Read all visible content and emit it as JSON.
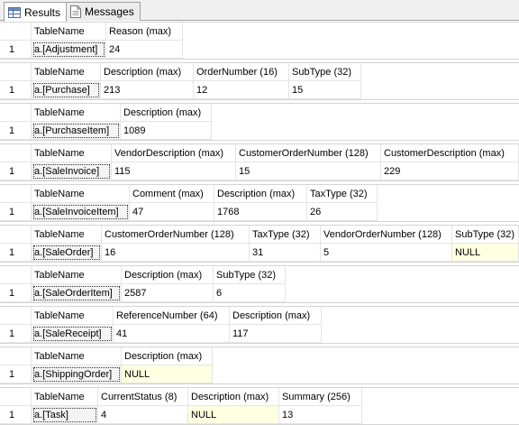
{
  "tabs": [
    {
      "label": "Results",
      "icon": "grid-icon",
      "active": true
    },
    {
      "label": "Messages",
      "icon": "document-icon",
      "active": false
    }
  ],
  "result_sets": [
    {
      "columns": [
        "TableName",
        "Reason (max)"
      ],
      "rows": [
        [
          "1",
          "a.[Adjustment]",
          "24"
        ]
      ]
    },
    {
      "columns": [
        "TableName",
        "Description (max)",
        "OrderNumber (16)",
        "SubType (32)"
      ],
      "rows": [
        [
          "1",
          "a.[Purchase]",
          "213",
          "12",
          "15"
        ]
      ]
    },
    {
      "columns": [
        "TableName",
        "Description (max)"
      ],
      "rows": [
        [
          "1",
          "a.[PurchaseItem]",
          "1089"
        ]
      ]
    },
    {
      "columns": [
        "TableName",
        "VendorDescription (max)",
        "CustomerOrderNumber (128)",
        "CustomerDescription (max)"
      ],
      "rows": [
        [
          "1",
          "a.[SaleInvoice]",
          "115",
          "15",
          "229"
        ]
      ]
    },
    {
      "columns": [
        "TableName",
        "Comment (max)",
        "Description (max)",
        "TaxType (32)"
      ],
      "rows": [
        [
          "1",
          "a.[SaleInvoiceItem]",
          "47",
          "1768",
          "26"
        ]
      ]
    },
    {
      "columns": [
        "TableName",
        "CustomerOrderNumber (128)",
        "TaxType (32)",
        "VendorOrderNumber (128)",
        "SubType (32)"
      ],
      "rows": [
        [
          "1",
          "a.[SaleOrder]",
          "16",
          "31",
          "5",
          "NULL"
        ]
      ]
    },
    {
      "columns": [
        "TableName",
        "Description (max)",
        "SubType (32)"
      ],
      "rows": [
        [
          "1",
          "a.[SaleOrderItem]",
          "2587",
          "6"
        ]
      ]
    },
    {
      "columns": [
        "TableName",
        "ReferenceNumber (64)",
        "Description (max)"
      ],
      "rows": [
        [
          "1",
          "a.[SaleReceipt]",
          "41",
          "117"
        ]
      ]
    },
    {
      "columns": [
        "TableName",
        "Description (max)"
      ],
      "rows": [
        [
          "1",
          "a.[ShippingOrder]",
          "NULL"
        ]
      ]
    },
    {
      "columns": [
        "TableName",
        "CurrentStatus (8)",
        "Description (max)",
        "Summary (256)"
      ],
      "rows": [
        [
          "1",
          "a.[Task]",
          "4",
          "NULL",
          "13"
        ]
      ]
    }
  ]
}
